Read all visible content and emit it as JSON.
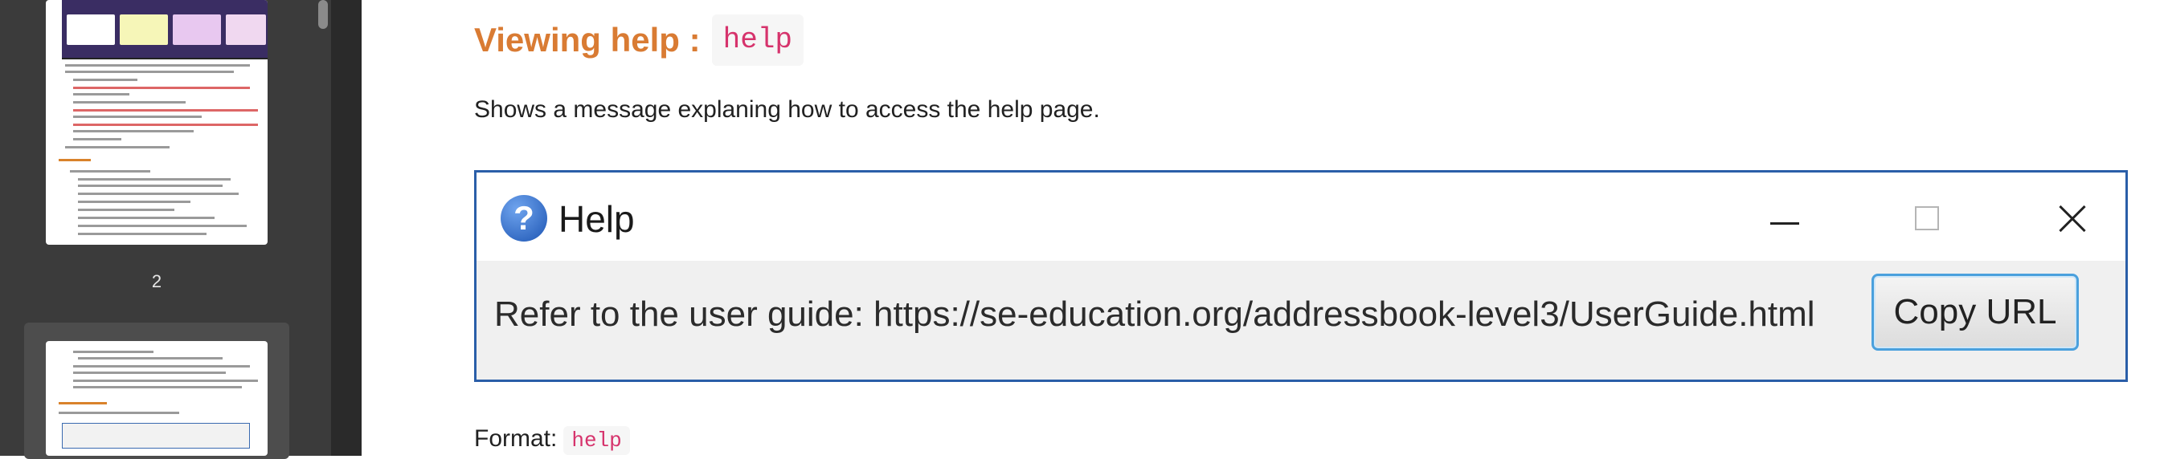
{
  "sidebar": {
    "page_number": "2"
  },
  "section": {
    "heading": "Viewing help :",
    "heading_code": "help",
    "description": "Shows a message explaning how to access the help page."
  },
  "help_window": {
    "title": "Help",
    "message": "Refer to the user guide: https://se-education.org/addressbook-level3/UserGuide.html",
    "copy_button_label": "Copy URL"
  },
  "format": {
    "label": "Format:",
    "code": "help"
  },
  "colors": {
    "heading": "#d97b33",
    "code": "#d6336c",
    "window_border": "#2a5ea8",
    "button_focus": "#4aa0dd"
  }
}
